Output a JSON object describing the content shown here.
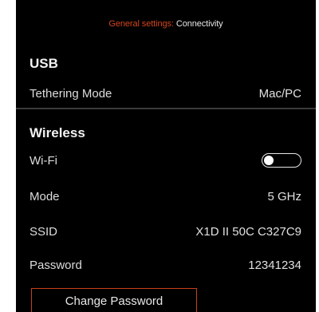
{
  "header": {
    "parent": "General settings:",
    "current": "Connectivity",
    "accent_color": "#d2451e"
  },
  "usb": {
    "title": "USB",
    "tethering_label": "Tethering Mode",
    "tethering_value": "Mac/PC"
  },
  "wireless": {
    "title": "Wireless",
    "wifi_label": "Wi-Fi",
    "wifi_enabled": false,
    "mode_label": "Mode",
    "mode_value": "5 GHz",
    "ssid_label": "SSID",
    "ssid_value": "X1D II 50C C327C9",
    "password_label": "Password",
    "password_value": "12341234",
    "change_password_label": "Change Password"
  }
}
